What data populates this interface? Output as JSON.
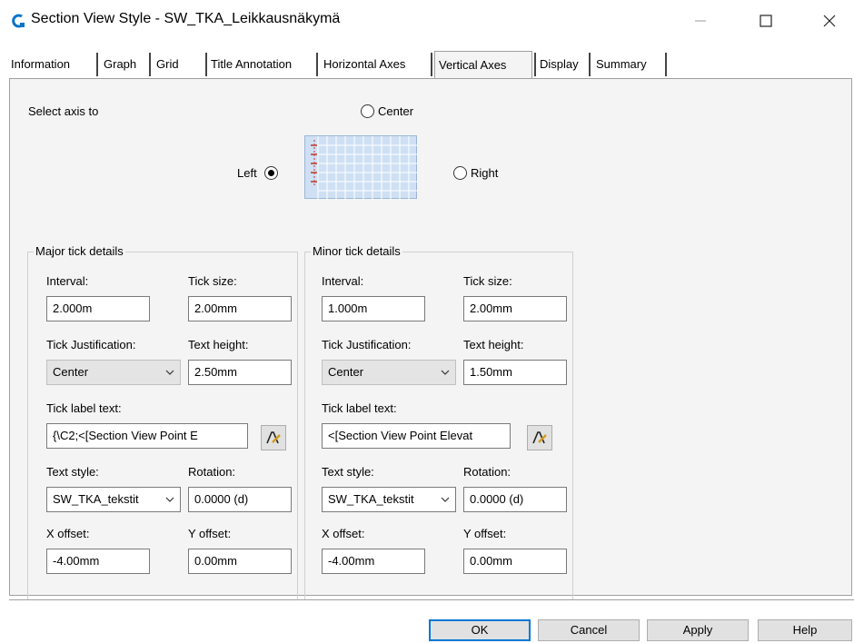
{
  "window": {
    "title": "Section View Style - SW_TKA_Leikkausnäkymä",
    "app_icon": "civil3d-icon",
    "controls": [
      "minimize-icon",
      "maximize-icon",
      "close-icon"
    ]
  },
  "tabs": [
    "Information",
    "Graph",
    "Grid",
    "Title Annotation",
    "Horizontal Axes",
    "Vertical Axes",
    "Display",
    "Summary"
  ],
  "active_tab": "Vertical Axes",
  "axis_select": {
    "label": "Select axis to",
    "center": "Center",
    "left": "Left",
    "right": "Right",
    "selected": "Left"
  },
  "major": {
    "legend": "Major tick details",
    "interval_label": "Interval:",
    "interval": "2.000m",
    "tick_size_label": "Tick size:",
    "tick_size": "2.00mm",
    "justification_label": "Tick Justification:",
    "justification": "Center",
    "text_height_label": "Text height:",
    "text_height": "2.50mm",
    "label_text_label": "Tick label text:",
    "label_text": "{\\C2;<[Section View Point E",
    "text_style_label": "Text style:",
    "text_style": "SW_TKA_tekstit",
    "rotation_label": "Rotation:",
    "rotation": "0.0000 (d)",
    "x_offset_label": "X offset:",
    "x_offset": "-4.00mm",
    "y_offset_label": "Y offset:",
    "y_offset": "0.00mm"
  },
  "minor": {
    "legend": "Minor tick details",
    "interval_label": "Interval:",
    "interval": "1.000m",
    "tick_size_label": "Tick size:",
    "tick_size": "2.00mm",
    "justification_label": "Tick Justification:",
    "justification": "Center",
    "text_height_label": "Text height:",
    "text_height": "1.50mm",
    "label_text_label": "Tick label text:",
    "label_text": "<[Section View Point Elevat",
    "text_style_label": "Text style:",
    "text_style": "SW_TKA_tekstit",
    "rotation_label": "Rotation:",
    "rotation": "0.0000 (d)",
    "x_offset_label": "X offset:",
    "x_offset": "-4.00mm",
    "y_offset_label": "Y offset:",
    "y_offset": "0.00mm"
  },
  "buttons": {
    "ok": "OK",
    "cancel": "Cancel",
    "apply": "Apply",
    "help": "Help"
  },
  "colors": {
    "accent": "#0078d7",
    "grid_fill": "#cfe0f4",
    "tick_marker": "#c0392b"
  }
}
